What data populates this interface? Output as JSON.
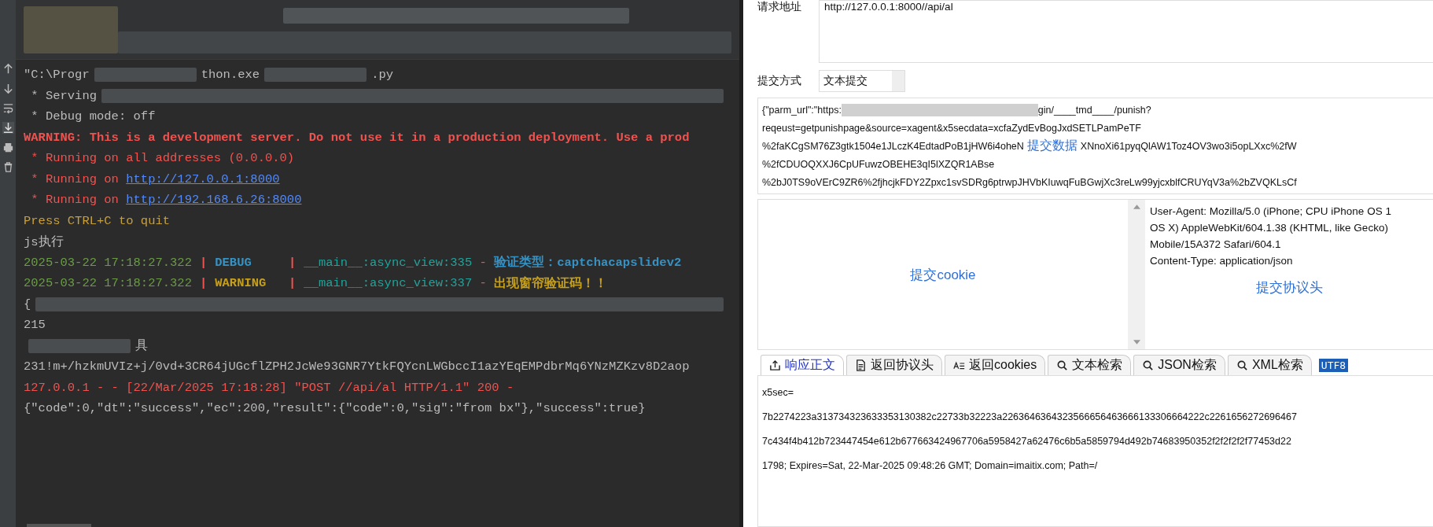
{
  "console": {
    "lines": [
      {
        "segments": [
          {
            "kind": "text",
            "text": "\"C:\\Progr",
            "color": "#bbbbbb",
            "bold": false
          },
          {
            "kind": "blur"
          },
          {
            "kind": "text",
            "text": "thon.exe",
            "color": "#bbbbbb",
            "bold": false
          },
          {
            "kind": "blur"
          },
          {
            "kind": "text",
            "text": ".py",
            "color": "#bbbbbb",
            "bold": false
          }
        ]
      },
      {
        "segments": [
          {
            "kind": "text",
            "text": " * Serving",
            "color": "#bbbbbb",
            "bold": false
          },
          {
            "kind": "blur"
          }
        ]
      },
      {
        "segments": [
          {
            "kind": "text",
            "text": " * Debug mode: off",
            "color": "#bbbbbb",
            "bold": false
          }
        ]
      },
      {
        "segments": [
          {
            "kind": "text",
            "text": "WARNING: This is a development server. Do not use it in a production deployment. Use a prod",
            "color": "#f0524f",
            "bold": true
          }
        ]
      },
      {
        "segments": [
          {
            "kind": "text",
            "text": " * Running on all addresses (0.0.0.0)",
            "color": "#f0524f",
            "bold": false
          }
        ]
      },
      {
        "segments": [
          {
            "kind": "text",
            "text": " * Running on ",
            "color": "#f0524f",
            "bold": false
          },
          {
            "kind": "link",
            "text": "http://127.0.0.1:8000",
            "color": "#548af7",
            "bold": false
          }
        ]
      },
      {
        "segments": [
          {
            "kind": "text",
            "text": " * Running on ",
            "color": "#f0524f",
            "bold": false
          },
          {
            "kind": "link",
            "text": "http://192.168.6.26:8000",
            "color": "#548af7",
            "bold": false
          }
        ]
      },
      {
        "segments": [
          {
            "kind": "text",
            "text": "Press CTRL+C to quit",
            "color": "#c7a03c",
            "bold": false
          }
        ]
      },
      {
        "segments": [
          {
            "kind": "text",
            "text": "js执行",
            "color": "#bbbbbb",
            "bold": false
          }
        ]
      },
      {
        "segments": [
          {
            "kind": "text",
            "text": "2025-03-22 17:18:27.322",
            "color": "#6a9c45",
            "bold": false
          },
          {
            "kind": "sep",
            "text": "|",
            "color": "#f0524f"
          },
          {
            "kind": "text",
            "text": "DEBUG    ",
            "color": "#3592c4",
            "bold": true
          },
          {
            "kind": "sep",
            "text": "|",
            "color": "#f0524f"
          },
          {
            "kind": "text",
            "text": "__main__:async_view:335",
            "color": "#1fa39a",
            "bold": false
          },
          {
            "kind": "text",
            "text": " - ",
            "color": "#f0524f",
            "bold": false
          },
          {
            "kind": "text",
            "text": "验证类型：captchacapslidev2",
            "color": "#3592c4",
            "bold": true
          }
        ]
      },
      {
        "segments": [
          {
            "kind": "text",
            "text": "2025-03-22 17:18:27.322",
            "color": "#6a9c45",
            "bold": false
          },
          {
            "kind": "sep",
            "text": "|",
            "color": "#f0524f"
          },
          {
            "kind": "text",
            "text": "WARNING  ",
            "color": "#c7a01b",
            "bold": true
          },
          {
            "kind": "sep",
            "text": "|",
            "color": "#f0524f"
          },
          {
            "kind": "text",
            "text": "__main__:async_view:337",
            "color": "#1fa39a",
            "bold": false
          },
          {
            "kind": "text",
            "text": " - ",
            "color": "#f0524f",
            "bold": false
          },
          {
            "kind": "text",
            "text": "出现窗帘验证码！！",
            "color": "#c7a01b",
            "bold": true
          }
        ]
      },
      {
        "segments": [
          {
            "kind": "text",
            "text": "{",
            "color": "#bbbbbb",
            "bold": false
          },
          {
            "kind": "blur"
          }
        ]
      },
      {
        "segments": [
          {
            "kind": "text",
            "text": "215",
            "color": "#bbbbbb",
            "bold": false
          }
        ]
      },
      {
        "segments": [
          {
            "kind": "blur"
          },
          {
            "kind": "text",
            "text": "具",
            "color": "#bbbbbb",
            "bold": false
          }
        ]
      },
      {
        "segments": [
          {
            "kind": "text",
            "text": "231!m+/hzkmUVIz+j/0vd+3CR64jUGcflZPH2JcWe93GNR7YtkFQYcnLWGbccI1azYEqEMPdbrMq6YNzMZKzv8D2aop",
            "color": "#bbbbbb",
            "bold": false
          }
        ]
      },
      {
        "segments": [
          {
            "kind": "text",
            "text": "127.0.0.1 - - [22/Mar/2025 17:18:28] \"POST //api/al HTTP/1.1\" 200 -",
            "color": "#f0524f",
            "bold": false
          }
        ]
      },
      {
        "segments": [
          {
            "kind": "text",
            "text": "{\"code\":0,\"dt\":\"success\",\"ec\":200,\"result\":{\"code\":0,\"sig\":\"from bx\"},\"success\":true}",
            "color": "#bbbbbb",
            "bold": false
          }
        ]
      }
    ]
  },
  "request": {
    "url_label": "请求地址",
    "url": "http://127.0.0.1:8000//api/al",
    "method_label": "提交方式",
    "method": "文本提交",
    "body_lines": [
      [
        {
          "kind": "text",
          "text": "{\"parm_url\":\"https:"
        },
        {
          "kind": "blur"
        },
        {
          "kind": "text",
          "text": "gin/____tmd____/punish?"
        }
      ],
      [
        {
          "kind": "text",
          "text": "reqeust=getpunishpage&source=xagent&x5secdata=xcfaZydEvBogJxdSETLPamPeTF"
        }
      ],
      [
        {
          "kind": "text",
          "text": "%2faKCgSM76Z3gtk1504e1JLczK4EdtadPoB1jHW6i4oheN"
        },
        {
          "kind": "label",
          "text": "提交数据"
        },
        {
          "kind": "text",
          "text": "XNnoXi61pyqQlAW1Toz4OV3wo3i5opLXxc%2fW"
        }
      ],
      [
        {
          "kind": "text",
          "text": "%2fCDUOQXXJ6CpUFuwzOBEHE3qI5lXZQR1ABse"
        }
      ],
      [
        {
          "kind": "text",
          "text": "%2bJ0TS9oVErC9ZR6%2fjhcjkFDY2Zpxc1svSDRg6ptrwpJHVbKIuwqFuBGwjXc3reLw99yjcxblfCRUYqV3a%2bZVQKLsCf"
        }
      ]
    ],
    "cookie_label": "提交cookie",
    "header_lines": [
      "User-Agent: Mozilla/5.0 (iPhone; CPU iPhone OS 1",
      "OS X) AppleWebKit/604.1.38 (KHTML, like Gecko)",
      "Mobile/15A372 Safari/604.1",
      "Content-Type: application/json"
    ],
    "header_label": "提交协议头"
  },
  "response": {
    "tabs": [
      {
        "label": "响应正文",
        "kind": "export",
        "selected": true
      },
      {
        "label": "返回协议头",
        "kind": "document",
        "selected": false
      },
      {
        "label": "返回cookies",
        "kind": "attribute",
        "selected": false
      },
      {
        "label": "文本检索",
        "kind": "search",
        "selected": false
      },
      {
        "label": "JSON检索",
        "kind": "search",
        "selected": false
      },
      {
        "label": "XML检索",
        "kind": "search",
        "selected": false
      }
    ],
    "encoding_badge": "UTF8",
    "lines": [
      "x5sec=",
      "7b2274223a313734323633353130382c22733b32223a2263646364323566656463666133306664222c2261656272696467",
      "7c434f4b412b723447454e612b677663424967706a5958427a62476c6b5a5859794d492b74683950352f2f2f2f2f77453d22",
      "1798; Expires=Sat, 22-Mar-2025 09:48:26 GMT; Domain=imaitix.com; Path=/"
    ]
  }
}
